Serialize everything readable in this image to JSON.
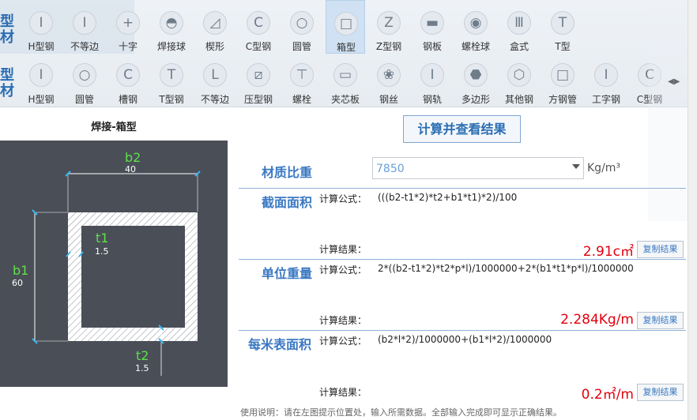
{
  "toolbar": {
    "side_label_1": "型材",
    "side_label_2": "型材",
    "row1": [
      {
        "label": "H型钢",
        "icon": "I"
      },
      {
        "label": "不等边",
        "icon": "I"
      },
      {
        "label": "十字",
        "icon": "+"
      },
      {
        "label": "焊接球",
        "icon": "◓"
      },
      {
        "label": "楔形",
        "icon": "◿"
      },
      {
        "label": "C型钢",
        "icon": "C"
      },
      {
        "label": "圆管",
        "icon": "○"
      },
      {
        "label": "箱型",
        "icon": "□"
      },
      {
        "label": "Z型钢",
        "icon": "Z"
      },
      {
        "label": "钢板",
        "icon": "▬"
      },
      {
        "label": "螺栓球",
        "icon": "◉"
      },
      {
        "label": "盒式",
        "icon": "Ⅲ"
      },
      {
        "label": "T型",
        "icon": "T"
      }
    ],
    "row2": [
      {
        "label": "H型钢",
        "icon": "I"
      },
      {
        "label": "圆管",
        "icon": "○"
      },
      {
        "label": "槽钢",
        "icon": "C"
      },
      {
        "label": "T型钢",
        "icon": "T"
      },
      {
        "label": "不等边",
        "icon": "L"
      },
      {
        "label": "压型钢",
        "icon": "⧄"
      },
      {
        "label": "螺栓",
        "icon": "⊤"
      },
      {
        "label": "夹芯板",
        "icon": "▭"
      },
      {
        "label": "钢丝",
        "icon": "❀"
      },
      {
        "label": "钢轨",
        "icon": "I"
      },
      {
        "label": "多边形",
        "icon": "⬣"
      },
      {
        "label": "其他钢",
        "icon": "⬡"
      },
      {
        "label": "方钢管",
        "icon": "□"
      },
      {
        "label": "工字钢",
        "icon": "I"
      },
      {
        "label": "C型钢",
        "icon": "C"
      }
    ],
    "row2_nav": "◀▶"
  },
  "diagram": {
    "title": "焊接-箱型",
    "b2_name": "b2",
    "b2_value": "40",
    "b1_name": "b1",
    "b1_value": "60",
    "t1_name": "t1",
    "t1_value": "1.5",
    "t2_name": "t2",
    "t2_value": "1.5"
  },
  "calc_button": "计算并查看结果",
  "density": {
    "label": "材质比重",
    "value": "7850",
    "unit": "Kg/m³"
  },
  "sections": [
    {
      "title": "截面面积",
      "formula_label": "计算公式：",
      "formula": "(((b2-t1*2)*t2+b1*t1)*2)/100",
      "result_label": "计算结果：",
      "result": "2.91c㎡",
      "copy": "复制结果"
    },
    {
      "title": "单位重量",
      "formula_label": "计算公式：",
      "formula": "2*((b2-t1*2)*t2*p*l)/1000000+2*(b1*t1*p*l)/1000000",
      "result_label": "计算结果：",
      "result": "2.284Kg/m",
      "copy": "复制结果"
    },
    {
      "title": "每米表面积",
      "formula_label": "计算公式：",
      "formula": "(b2*l*2)/1000000+(b1*l*2)/1000000",
      "result_label": "计算结果：",
      "result": "0.2㎡/m",
      "copy": "复制结果"
    }
  ],
  "footer_note": "使用说明：请在左图提示位置处，输入所需数据。全部输入完成即可显示正确结果。",
  "colors": {
    "accent": "#3a78c2",
    "result_red": "#e3000f",
    "dimension_green": "#5ee04a",
    "diagram_bg": "#4a4e57"
  }
}
